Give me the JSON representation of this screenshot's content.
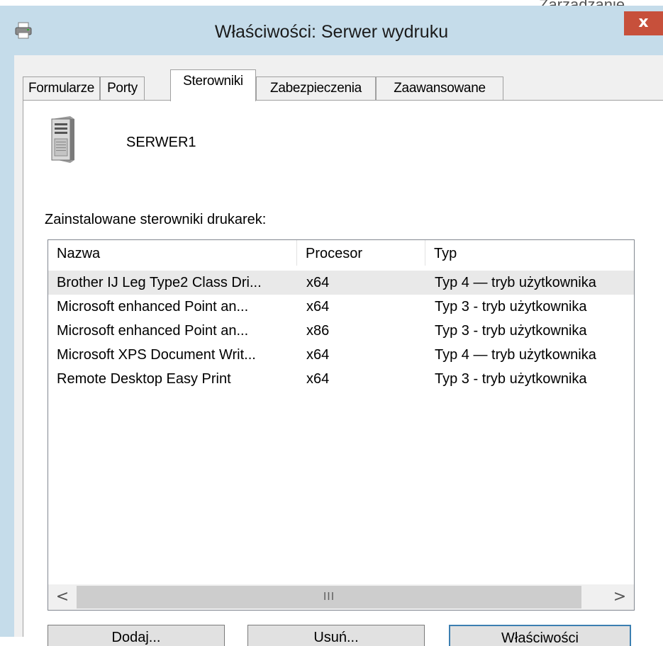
{
  "background": {
    "peek_text": "Zarządzanie"
  },
  "window": {
    "title": "Właściwości: Serwer wydruku",
    "close_label": "x",
    "title_icon": "printer-icon"
  },
  "tabs": [
    {
      "label": "Formularze",
      "active": false
    },
    {
      "label": "Porty",
      "active": false
    },
    {
      "label": "Sterowniki",
      "active": true
    },
    {
      "label": "Zabezpieczenia",
      "active": false
    },
    {
      "label": "Zaawansowane",
      "active": false
    }
  ],
  "server": {
    "icon": "server-icon",
    "name": "SERWER1"
  },
  "drivers": {
    "label": "Zainstalowane sterowniki drukarek:",
    "columns": [
      "Nazwa",
      "Procesor",
      "Typ"
    ],
    "rows": [
      {
        "name": "Brother IJ Leg Type2 Class Dri...",
        "processor": "x64",
        "type": "Typ 4 — tryb użytkownika",
        "selected": true
      },
      {
        "name": "Microsoft enhanced Point an...",
        "processor": "x64",
        "type": "Typ 3 - tryb użytkownika",
        "selected": false
      },
      {
        "name": "Microsoft enhanced Point an...",
        "processor": "x86",
        "type": "Typ 3 - tryb użytkownika",
        "selected": false
      },
      {
        "name": "Microsoft XPS Document Writ...",
        "processor": "x64",
        "type": "Typ 4 — tryb użytkownika",
        "selected": false
      },
      {
        "name": "Remote Desktop Easy Print",
        "processor": "x64",
        "type": "Typ 3 - tryb użytkownika",
        "selected": false
      }
    ],
    "scroll": {
      "left_arrow": "<",
      "right_arrow": ">",
      "grip": "III"
    }
  },
  "buttons": [
    {
      "label": "Dodaj...",
      "default": false
    },
    {
      "label": "Usuń...",
      "default": false
    },
    {
      "label": "Właściwości",
      "default": true
    }
  ],
  "colors": {
    "titlebar": "#c5dcea",
    "close": "#c7503b",
    "selection": "#e9e9e9"
  }
}
